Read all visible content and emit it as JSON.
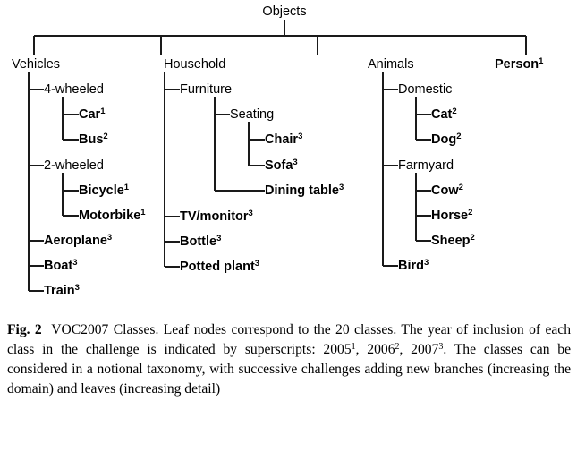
{
  "figure": {
    "root": {
      "label": "Objects"
    },
    "level1": [
      {
        "label": "Vehicles",
        "bold": false
      },
      {
        "label": "Household",
        "bold": false
      },
      {
        "label": "Animals",
        "bold": false
      },
      {
        "label": "Person",
        "sup": "1",
        "bold": true
      }
    ],
    "vehicles": {
      "branches": [
        {
          "label": "4-wheeled"
        },
        {
          "label": "2-wheeled"
        }
      ],
      "four_wheeled_leaves": [
        {
          "label": "Car",
          "sup": "1"
        },
        {
          "label": "Bus",
          "sup": "2"
        }
      ],
      "two_wheeled_leaves": [
        {
          "label": "Bicycle",
          "sup": "1"
        },
        {
          "label": "Motorbike",
          "sup": "1"
        }
      ],
      "direct_leaves": [
        {
          "label": "Aeroplane",
          "sup": "3"
        },
        {
          "label": "Boat",
          "sup": "3"
        },
        {
          "label": "Train",
          "sup": "3"
        }
      ]
    },
    "household": {
      "branches": [
        {
          "label": "Furniture"
        },
        {
          "label": "Seating"
        }
      ],
      "seating_leaves": [
        {
          "label": "Chair",
          "sup": "3"
        },
        {
          "label": "Sofa",
          "sup": "3"
        }
      ],
      "furniture_leaves": [
        {
          "label": "Dining table",
          "sup": "3"
        }
      ],
      "direct_leaves": [
        {
          "label": "TV/monitor",
          "sup": "3"
        },
        {
          "label": "Bottle",
          "sup": "3"
        },
        {
          "label": "Potted plant",
          "sup": "3"
        }
      ]
    },
    "animals": {
      "branches": [
        {
          "label": "Domestic"
        },
        {
          "label": "Farmyard"
        }
      ],
      "domestic_leaves": [
        {
          "label": "Cat",
          "sup": "2"
        },
        {
          "label": "Dog",
          "sup": "2"
        }
      ],
      "farmyard_leaves": [
        {
          "label": "Cow",
          "sup": "2"
        },
        {
          "label": "Horse",
          "sup": "2"
        },
        {
          "label": "Sheep",
          "sup": "2"
        }
      ],
      "direct_leaves": [
        {
          "label": "Bird",
          "sup": "3"
        }
      ]
    },
    "line_color": "#1a1a1a",
    "text_color": "#000000",
    "background_color": "#ffffff"
  },
  "caption": {
    "figure_label": "Fig. 2",
    "seg1": "VOC2007 Classes. Leaf nodes correspond to the 20 classes. The year of inclusion of each class in the challenge is indicated by superscripts: 2005",
    "sup1": "1",
    "seg2": ", 2006",
    "sup2": "2",
    "seg3": ", 2007",
    "sup3": "3",
    "seg4": ". The classes can be considered in a notional taxonomy, with successive challenges adding new branches (increasing the domain) and leaves (increasing detail)"
  },
  "chart_data": {
    "type": "table",
    "title": "VOC2007 Classes taxonomy tree",
    "root": "Objects",
    "nodes": [
      {
        "label": "Objects",
        "depth": 0,
        "parent": null,
        "type": "root",
        "year_sup": null
      },
      {
        "label": "Vehicles",
        "depth": 1,
        "parent": "Objects",
        "type": "branch",
        "year_sup": null
      },
      {
        "label": "4-wheeled",
        "depth": 2,
        "parent": "Vehicles",
        "type": "branch",
        "year_sup": null
      },
      {
        "label": "Car",
        "depth": 3,
        "parent": "4-wheeled",
        "type": "leaf",
        "year_sup": "1"
      },
      {
        "label": "Bus",
        "depth": 3,
        "parent": "4-wheeled",
        "type": "leaf",
        "year_sup": "2"
      },
      {
        "label": "2-wheeled",
        "depth": 2,
        "parent": "Vehicles",
        "type": "branch",
        "year_sup": null
      },
      {
        "label": "Bicycle",
        "depth": 3,
        "parent": "2-wheeled",
        "type": "leaf",
        "year_sup": "1"
      },
      {
        "label": "Motorbike",
        "depth": 3,
        "parent": "2-wheeled",
        "type": "leaf",
        "year_sup": "1"
      },
      {
        "label": "Aeroplane",
        "depth": 2,
        "parent": "Vehicles",
        "type": "leaf",
        "year_sup": "3"
      },
      {
        "label": "Boat",
        "depth": 2,
        "parent": "Vehicles",
        "type": "leaf",
        "year_sup": "3"
      },
      {
        "label": "Train",
        "depth": 2,
        "parent": "Vehicles",
        "type": "leaf",
        "year_sup": "3"
      },
      {
        "label": "Household",
        "depth": 1,
        "parent": "Objects",
        "type": "branch",
        "year_sup": null
      },
      {
        "label": "Furniture",
        "depth": 2,
        "parent": "Household",
        "type": "branch",
        "year_sup": null
      },
      {
        "label": "Seating",
        "depth": 3,
        "parent": "Furniture",
        "type": "branch",
        "year_sup": null
      },
      {
        "label": "Chair",
        "depth": 4,
        "parent": "Seating",
        "type": "leaf",
        "year_sup": "3"
      },
      {
        "label": "Sofa",
        "depth": 4,
        "parent": "Seating",
        "type": "leaf",
        "year_sup": "3"
      },
      {
        "label": "Dining table",
        "depth": 3,
        "parent": "Furniture",
        "type": "leaf",
        "year_sup": "3"
      },
      {
        "label": "TV/monitor",
        "depth": 2,
        "parent": "Household",
        "type": "leaf",
        "year_sup": "3"
      },
      {
        "label": "Bottle",
        "depth": 2,
        "parent": "Household",
        "type": "leaf",
        "year_sup": "3"
      },
      {
        "label": "Potted plant",
        "depth": 2,
        "parent": "Household",
        "type": "leaf",
        "year_sup": "3"
      },
      {
        "label": "Animals",
        "depth": 1,
        "parent": "Objects",
        "type": "branch",
        "year_sup": null
      },
      {
        "label": "Domestic",
        "depth": 2,
        "parent": "Animals",
        "type": "branch",
        "year_sup": null
      },
      {
        "label": "Cat",
        "depth": 3,
        "parent": "Domestic",
        "type": "leaf",
        "year_sup": "2"
      },
      {
        "label": "Dog",
        "depth": 3,
        "parent": "Domestic",
        "type": "leaf",
        "year_sup": "2"
      },
      {
        "label": "Farmyard",
        "depth": 2,
        "parent": "Animals",
        "type": "branch",
        "year_sup": null
      },
      {
        "label": "Cow",
        "depth": 3,
        "parent": "Farmyard",
        "type": "leaf",
        "year_sup": "2"
      },
      {
        "label": "Horse",
        "depth": 3,
        "parent": "Farmyard",
        "type": "leaf",
        "year_sup": "2"
      },
      {
        "label": "Sheep",
        "depth": 3,
        "parent": "Farmyard",
        "type": "leaf",
        "year_sup": "2"
      },
      {
        "label": "Bird",
        "depth": 2,
        "parent": "Animals",
        "type": "leaf",
        "year_sup": "3"
      },
      {
        "label": "Person",
        "depth": 1,
        "parent": "Objects",
        "type": "leaf",
        "year_sup": "1"
      }
    ],
    "leaf_count": 20,
    "year_legend": {
      "1": "2005",
      "2": "2006",
      "3": "2007"
    }
  }
}
